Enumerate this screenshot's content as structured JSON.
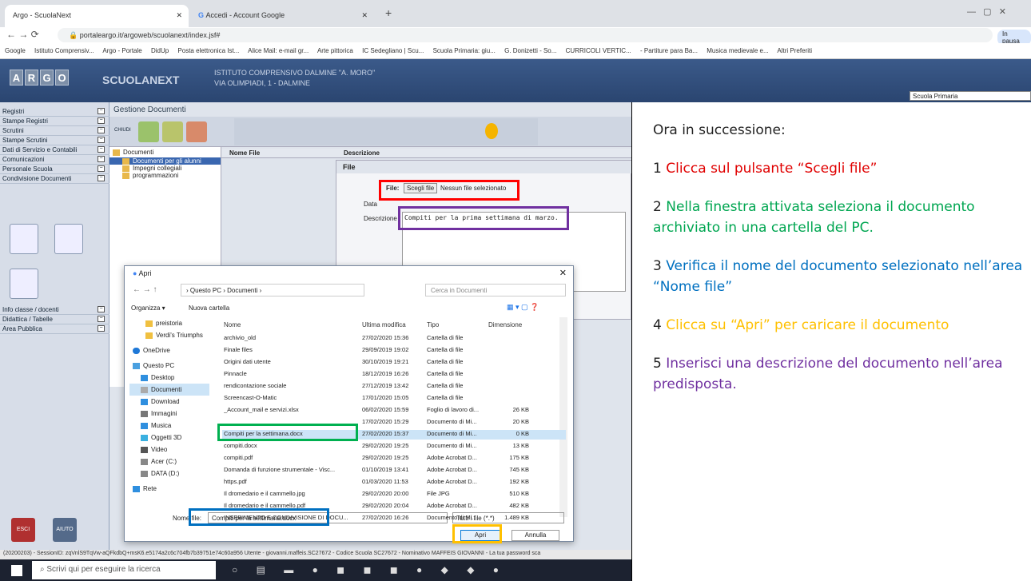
{
  "browser": {
    "tabs": [
      "Argo - ScuolaNext",
      "Accedi - Account Google"
    ],
    "url": "portaleargo.it/argoweb/scuolanext/index.jsf#",
    "profile": "In pausa",
    "bookmarks": [
      "Google",
      "Istituto Comprensiv...",
      "Argo - Portale",
      "DidUp",
      "Posta elettronica Ist...",
      "Alice Mail: e-mail gr...",
      "Arte pittorica",
      "IC Sedegliano | Scu...",
      "Scuola Primaria: giu...",
      "G. Donizetti - So...",
      "CURRICOLI VERTIC...",
      "- Partiture para Ba...",
      "Musica medievale e...",
      "Altri Preferiti"
    ]
  },
  "app": {
    "logo_letters": [
      "A",
      "R",
      "G",
      "O"
    ],
    "brand": "SCUOLANEXT",
    "school_name": "ISTITUTO COMPRENSIVO DALMINE \"A. MORO\"",
    "school_address": "VIA OLIMPIADI, 1 - DALMINE",
    "school_select": "Scuola Primaria",
    "section_title": "Gestione Documenti",
    "close_label": "CHIUDI",
    "sidebar": [
      "Registri",
      "Stampe Registri",
      "Scrutini",
      "Stampe Scrutini",
      "Dati di Servizio e Contabili",
      "Comunicazioni",
      "Personale Scuola",
      "Condivisione Documenti"
    ],
    "sidebar_bottom": [
      "Info classe / docenti",
      "Didattica / Tabelle",
      "Area Pubblica"
    ],
    "exit_label": "ESCI",
    "help_label": "AIUTO",
    "tree": [
      "Documenti",
      "Documenti per gli alunni",
      "Impegni collegiali",
      "programmazioni"
    ],
    "table_headers": [
      "Nome File",
      "Descrizione"
    ],
    "file_form": {
      "title": "File",
      "file_label": "File:",
      "choose_button": "Scegli file",
      "no_file": "Nessun file selezionato",
      "date_label": "Data",
      "description_label": "Descrizione",
      "description_value": "Compiti per la prima settimana di marzo."
    },
    "status": "(20200203) - SessionID: zqVnlS9TqVw-aQFkdbQ+msK6.e5174a2c6c704fb7b39751e74c60a956 Utente - giovanni.maffeis.SC27672 - Codice Scuola SC27672 - Nominativo MAFFEIS GIOVANNI   - La tua password sca"
  },
  "taskbar": {
    "search_placeholder": "Scrivi qui per eseguire la ricerca"
  },
  "dialog": {
    "title": "Apri",
    "path": [
      "Questo PC",
      "Documenti"
    ],
    "search_placeholder": "Cerca in Documenti",
    "organize": "Organizza ▾",
    "new_folder": "Nuova cartella",
    "nav": [
      "preistoria",
      "Verdi's Triumphs",
      "OneDrive",
      "Questo PC",
      "Desktop",
      "Documenti",
      "Download",
      "Immagini",
      "Musica",
      "Oggetti 3D",
      "Video",
      "Acer (C:)",
      "DATA (D:)",
      "Rete"
    ],
    "columns": [
      "Nome",
      "Ultima modifica",
      "Tipo",
      "Dimensione"
    ],
    "files": [
      {
        "name": "archivio_old",
        "date": "27/02/2020 15:36",
        "type": "Cartella di file",
        "size": ""
      },
      {
        "name": "Finale files",
        "date": "29/09/2019 19:02",
        "type": "Cartella di file",
        "size": ""
      },
      {
        "name": "Origini dati utente",
        "date": "30/10/2019 19:21",
        "type": "Cartella di file",
        "size": ""
      },
      {
        "name": "Pinnacle",
        "date": "18/12/2019 16:26",
        "type": "Cartella di file",
        "size": ""
      },
      {
        "name": "rendicontazione sociale",
        "date": "27/12/2019 13:42",
        "type": "Cartella di file",
        "size": ""
      },
      {
        "name": "Screencast-O-Matic",
        "date": "17/01/2020 15:05",
        "type": "Cartella di file",
        "size": ""
      },
      {
        "name": "_Account_mail e servizi.xlsx",
        "date": "06/02/2020 15:59",
        "type": "Foglio di lavoro di...",
        "size": "26 KB"
      },
      {
        "name": "",
        "date": "17/02/2020 15:29",
        "type": "Documento di Mi...",
        "size": "20 KB"
      },
      {
        "name": "Compiti per la settimana.docx",
        "date": "27/02/2020 15:37",
        "type": "Documento di Mi...",
        "size": "0 KB"
      },
      {
        "name": "compiti.docx",
        "date": "29/02/2020 19:25",
        "type": "Documento di Mi...",
        "size": "13 KB"
      },
      {
        "name": "compiti.pdf",
        "date": "29/02/2020 19:25",
        "type": "Adobe Acrobat D...",
        "size": "175 KB"
      },
      {
        "name": "Domanda di funzione strumentale - Visc...",
        "date": "01/10/2019 13:41",
        "type": "Adobe Acrobat D...",
        "size": "745 KB"
      },
      {
        "name": "https.pdf",
        "date": "01/03/2020 11:53",
        "type": "Adobe Acrobat D...",
        "size": "192 KB"
      },
      {
        "name": "Il dromedario e il cammello.jpg",
        "date": "29/02/2020 20:00",
        "type": "File JPG",
        "size": "510 KB"
      },
      {
        "name": "Il dromedario e il cammello.pdf",
        "date": "29/02/2020 20:04",
        "type": "Adobe Acrobat D...",
        "size": "482 KB"
      },
      {
        "name": "INSERIMENTO E CONDIVISIONE DI DOCU...",
        "date": "27/02/2020 16:26",
        "type": "Documento di Mi...",
        "size": "1.489 KB"
      }
    ],
    "filename_label": "Nome file:",
    "filename_value": "Compiti per la settimana.docx",
    "filter": "Tutti i file (*.*)",
    "open_button": "Apri",
    "cancel_button": "Annulla"
  },
  "instructions": {
    "intro": "Ora in successione:",
    "steps": [
      {
        "num": "1",
        "text": "Clicca sul pulsante “Scegli file”",
        "color": "#e00000"
      },
      {
        "num": "2",
        "text": "Nella finestra attivata seleziona il documento archiviato in una cartella del PC.",
        "color": "#00a651"
      },
      {
        "num": "3",
        "text": "Verifica il nome del documento selezionato nell’area “Nome file”",
        "color": "#0070c0"
      },
      {
        "num": "4",
        "text": "Clicca su “Apri” per caricare il documento",
        "color": "#ffc000"
      },
      {
        "num": "5",
        "text": "Inserisci una descrizione del documento nell’area predisposta.",
        "color": "#7030a0"
      }
    ]
  }
}
